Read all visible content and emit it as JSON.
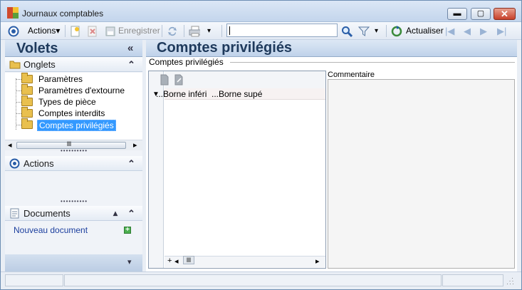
{
  "window": {
    "title": "Journaux comptables",
    "min_glyph": "▬",
    "max_glyph": "▢",
    "close_glyph": "✕"
  },
  "toolbar": {
    "actions_label": "Actions",
    "actions_caret": "▾",
    "save_label": "Enregistrer",
    "search_value": "",
    "refresh_label": "Actualiser",
    "filter_caret": "▾",
    "print_caret": "▾",
    "nav_first": "|◀",
    "nav_prev": "◀",
    "nav_next": "▶",
    "nav_last": "▶|"
  },
  "left": {
    "title": "Volets",
    "collapse": "«",
    "onglets": {
      "label": "Onglets",
      "toggle": "⌃",
      "items": [
        {
          "label": "Paramètres"
        },
        {
          "label": "Paramètres d'extourne"
        },
        {
          "label": "Types de pièce"
        },
        {
          "label": "Comptes interdits"
        },
        {
          "label": "Comptes privilégiés",
          "selected": true
        }
      ],
      "scroll_left": "◂",
      "scroll_right": "▸",
      "scroll_grip": "lll"
    },
    "actions": {
      "label": "Actions",
      "toggle": "⌃"
    },
    "documents": {
      "label": "Documents",
      "toggle_up": "▴",
      "toggle": "⌃",
      "new_doc": "Nouveau document"
    },
    "footer_caret": "▾"
  },
  "main": {
    "title": "Comptes privilégiés",
    "group_label": "Comptes privilégiés",
    "grid": {
      "expander": "▼",
      "columns": [
        "...Borne inféri",
        "...Borne supé"
      ],
      "add": "+",
      "scroll_left": "◂",
      "scroll_grip": "lll",
      "scroll_right": "▸"
    },
    "comment_label": "Commentaire",
    "comment_value": ""
  },
  "colors": {
    "accent": "#1f3a5c",
    "selection": "#3399ff",
    "link": "#1c3f9e"
  }
}
